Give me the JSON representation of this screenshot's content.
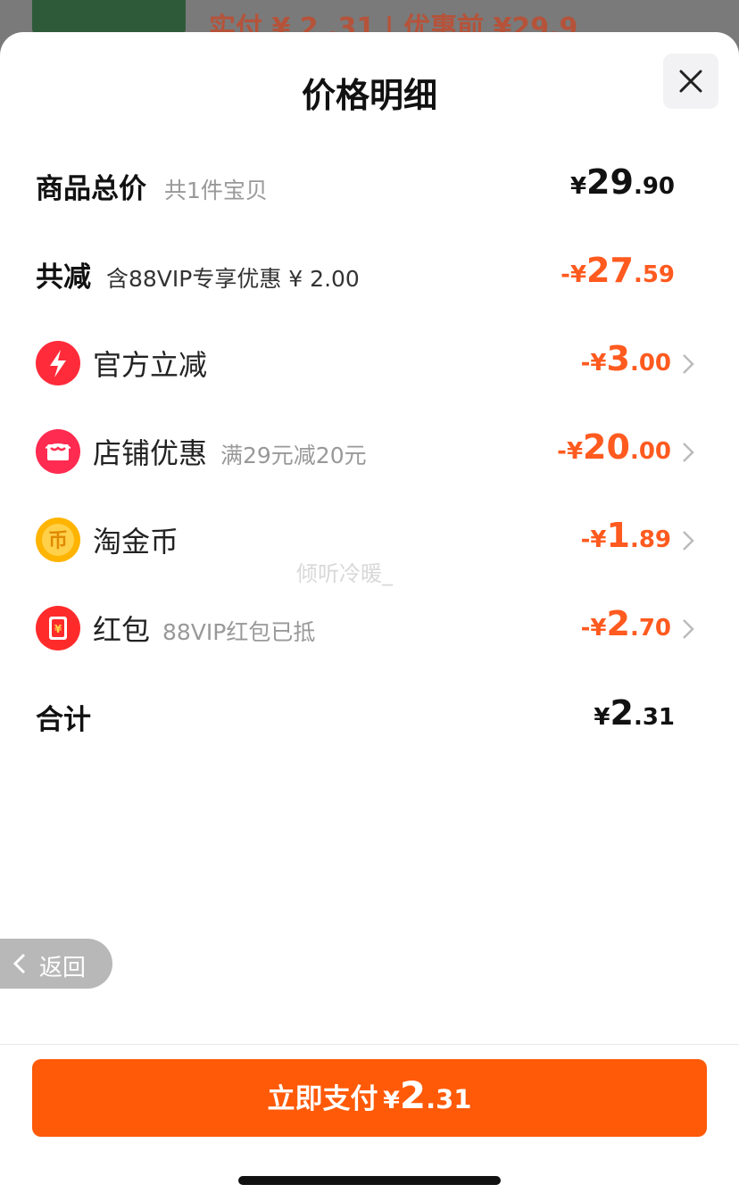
{
  "background_peek": {
    "text": "实付 ¥ 2 .31 | 优惠前 ¥29.9"
  },
  "sheet": {
    "title": "价格明细"
  },
  "rows": {
    "total": {
      "label": "商品总价",
      "sub": "共1件宝贝",
      "yen": "¥",
      "big": "29",
      "dec": ".90"
    },
    "discount": {
      "label": "共减",
      "sub": "含88VIP专享优惠 ¥ 2.00",
      "yen": "-¥",
      "big": "27",
      "dec": ".59"
    },
    "official": {
      "label": "官方立减",
      "sub": "",
      "yen": "-¥",
      "big": "3",
      "dec": ".00",
      "icon": "lightning-icon"
    },
    "store": {
      "label": "店铺优惠",
      "sub": "满29元减20元",
      "yen": "-¥",
      "big": "20",
      "dec": ".00",
      "icon": "store-icon"
    },
    "coins": {
      "label": "淘金币",
      "sub": "",
      "yen": "-¥",
      "big": "1",
      "dec": ".89",
      "icon": "coin-icon"
    },
    "redpacket": {
      "label": "红包",
      "sub": "88VIP红包已抵",
      "yen": "-¥",
      "big": "2",
      "dec": ".70",
      "icon": "red-packet-icon"
    },
    "sum": {
      "label": "合计",
      "yen": "¥",
      "big": "2",
      "dec": ".31"
    }
  },
  "watermark": "倾听冷暖_",
  "back": {
    "label": "返回"
  },
  "pay": {
    "label": "立即支付",
    "yen": "¥",
    "big": "2",
    "dec": ".31"
  },
  "colors": {
    "accent": "#ff5a08",
    "discount": "#ff5a1f",
    "text": "#111111"
  }
}
